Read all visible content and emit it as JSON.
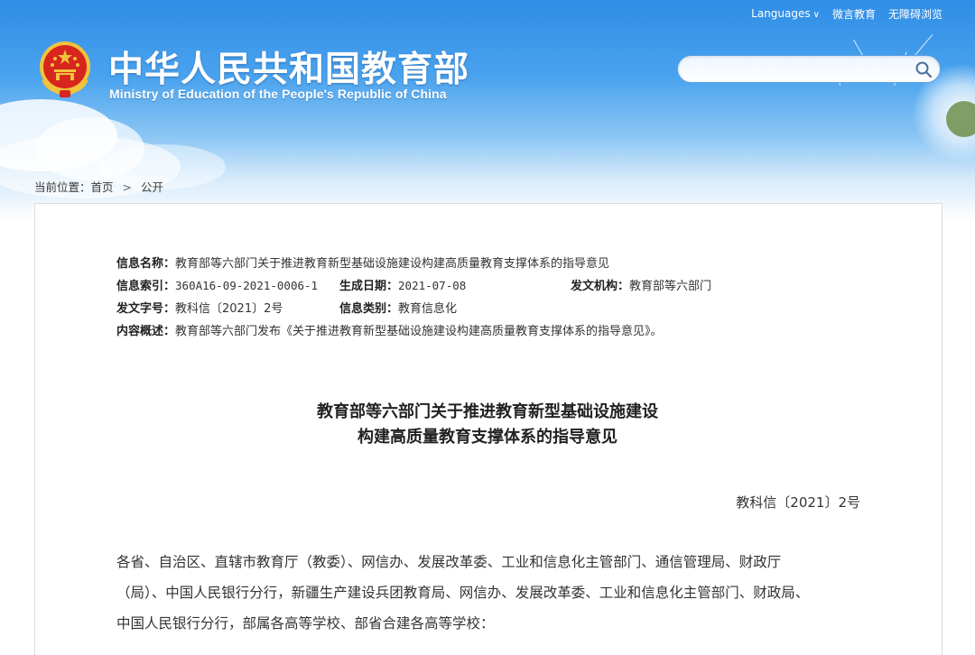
{
  "header": {
    "site_title": "中华人民共和国教育部",
    "site_subtitle": "Ministry of Education of the People's Republic of China",
    "top_links": {
      "languages": "Languages",
      "weibo": "微言教育",
      "accessibility": "无障碍浏览"
    },
    "search": {
      "value": "",
      "placeholder": ""
    },
    "icons": {
      "emblem": "national-emblem-icon",
      "search": "search-icon",
      "languages": "chevron-down-icon"
    }
  },
  "breadcrumb": {
    "prefix": "当前位置：",
    "items": [
      "首页",
      "公开"
    ],
    "separator": ">"
  },
  "meta": {
    "name_label": "信息名称：",
    "name_value": "教育部等六部门关于推进教育新型基础设施建设构建高质量教育支撑体系的指导意见",
    "index_label": "信息索引：",
    "index_value": "360A16-09-2021-0006-1",
    "date_label": "生成日期：",
    "date_value": "2021-07-08",
    "issuer_label": "发文机构：",
    "issuer_value": "教育部等六部门",
    "docno_label": "发文字号：",
    "docno_value": "教科信〔2021〕2号",
    "category_label": "信息类别：",
    "category_value": "教育信息化",
    "summary_label": "内容概述：",
    "summary_value": "教育部等六部门发布《关于推进教育新型基础设施建设构建高质量教育支撑体系的指导意见》。"
  },
  "document": {
    "title_line1": "教育部等六部门关于推进教育新型基础设施建设",
    "title_line2": "构建高质量教育支撑体系的指导意见",
    "doc_number": "教科信〔2021〕2号",
    "paragraph_lines": [
      "各省、自治区、直辖市教育厅（教委）、网信办、发展改革委、工业和信息化主管部门、通信管理局、财政厅",
      "（局）、中国人民银行分行，新疆生产建设兵团教育局、网信办、发展改革委、工业和信息化主管部门、财政局、",
      "中国人民银行分行，部属各高等学校、部省合建各高等学校："
    ]
  },
  "colors": {
    "banner_top": "#2f8de6",
    "emblem_red": "#d7261e",
    "emblem_gold": "#f3c33b",
    "search_border": "#5aa2e4",
    "text": "#333333"
  }
}
